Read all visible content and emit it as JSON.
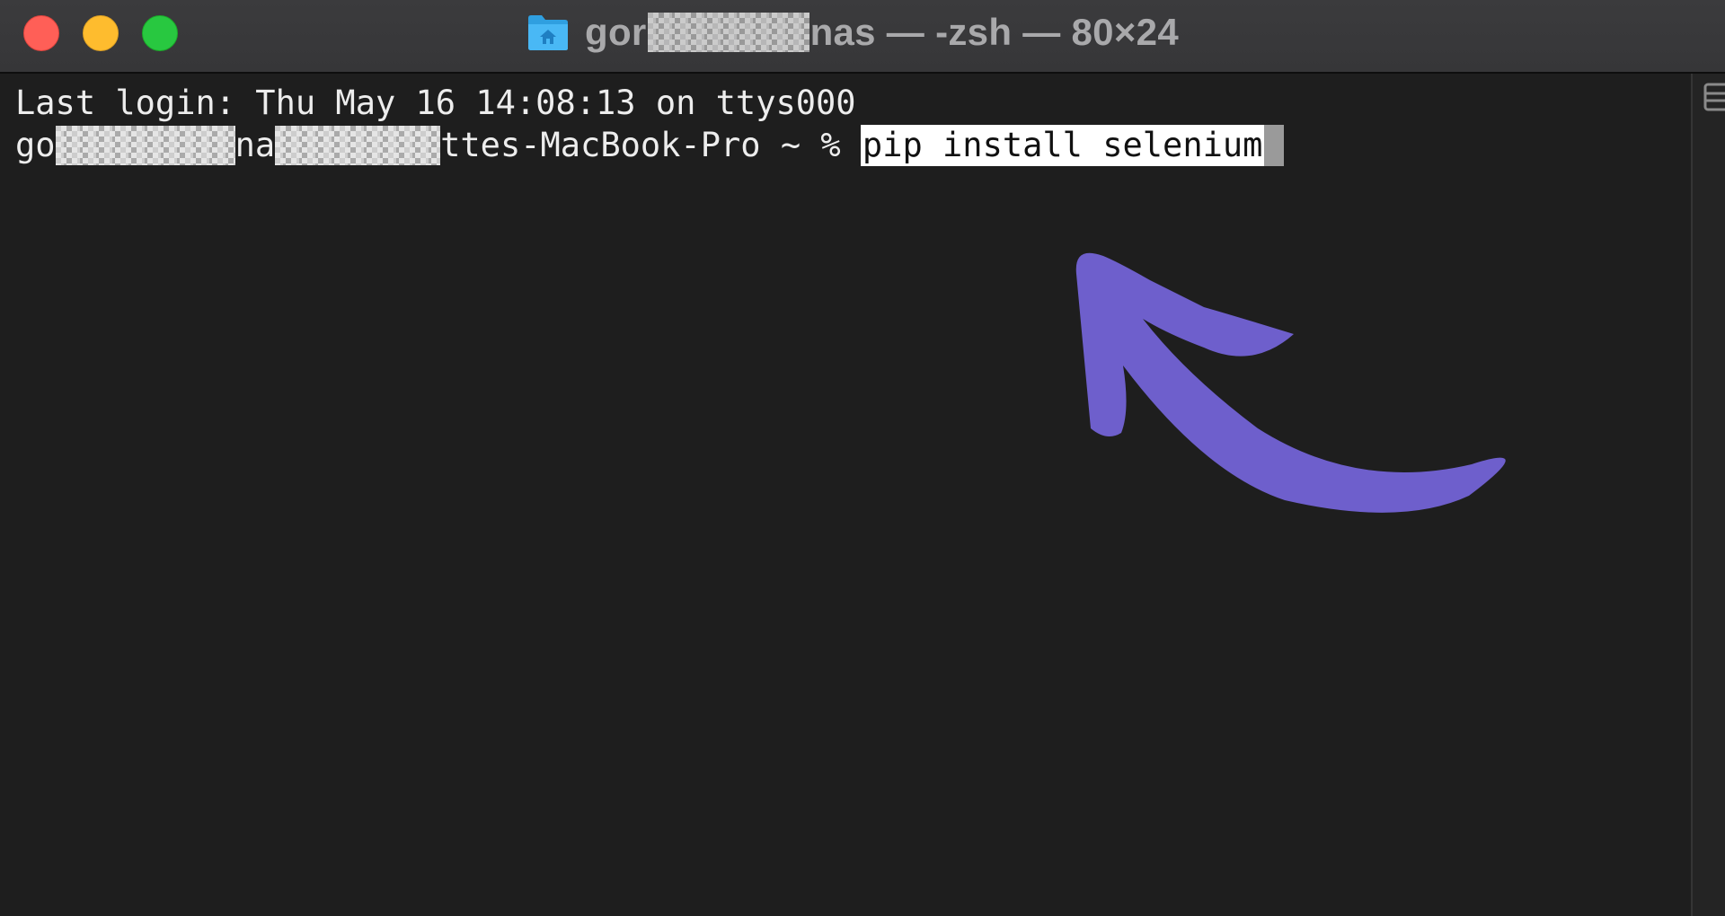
{
  "window": {
    "title_prefix": "gor",
    "title_suffix": "nas — -zsh — 80×24",
    "folder_icon": "home-folder-icon"
  },
  "terminal": {
    "last_login": "Last login: Thu May 16 14:08:13 on ttys000",
    "prompt_part1": "go",
    "prompt_part2": "na",
    "prompt_part3": "ttes-MacBook-Pro ~ % ",
    "command": "pip install selenium"
  },
  "annotation": {
    "arrow_icon": "curved-arrow-icon",
    "arrow_color": "#6e5fcc"
  },
  "colors": {
    "close": "#ff5f57",
    "minimize": "#febc2e",
    "zoom": "#28c840",
    "terminal_bg": "#1e1e1e",
    "titlebar_bg": "#3a3a3c"
  }
}
